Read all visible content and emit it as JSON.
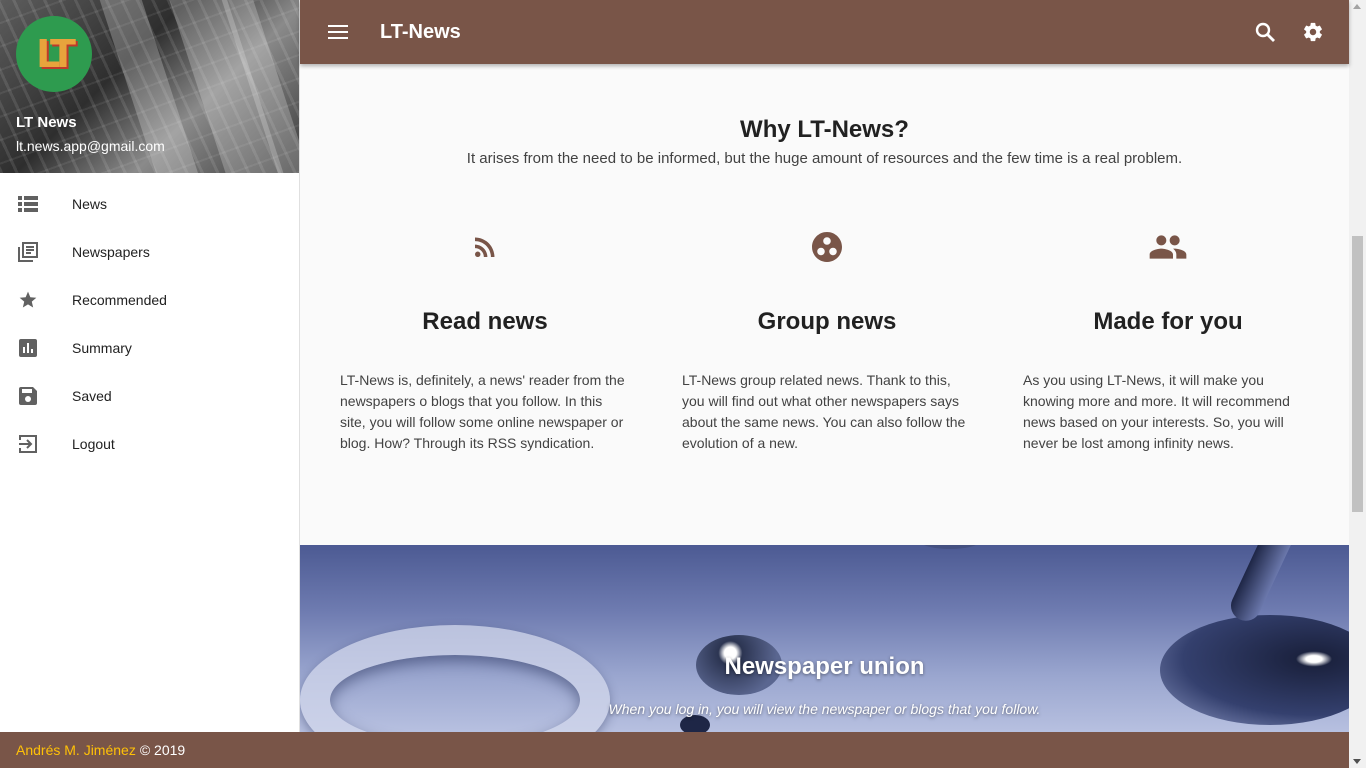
{
  "app": {
    "title": "LT-News",
    "brand_color": "#795548",
    "accent_color": "#ffc107"
  },
  "sidebar": {
    "avatar_text": "LT",
    "user_name": "LT News",
    "user_email": "lt.news.app@gmail.com",
    "items": [
      {
        "label": "News",
        "icon": "view-list-icon"
      },
      {
        "label": "Newspapers",
        "icon": "library-books-icon"
      },
      {
        "label": "Recommended",
        "icon": "star-icon"
      },
      {
        "label": "Summary",
        "icon": "bar-chart-icon"
      },
      {
        "label": "Saved",
        "icon": "save-icon"
      },
      {
        "label": "Logout",
        "icon": "exit-to-app-icon"
      }
    ]
  },
  "toolbar": {
    "menu_icon": "menu-icon",
    "search_icon": "search-icon",
    "settings_icon": "settings-icon"
  },
  "main": {
    "why_title": "Why LT-News?",
    "why_subtitle": "It arises from the need to be informed, but the huge amount of resources and the few time is a real problem.",
    "features": [
      {
        "icon": "rss-feed-icon",
        "title": "Read news",
        "text": "LT-News is, definitely, a news' reader from the newspapers o blogs that you follow. In this site, you will follow some online newspaper or blog. How? Through its RSS syndication."
      },
      {
        "icon": "group-work-icon",
        "title": "Group news",
        "text": "LT-News group related news. Thank to this, you will find out what other newspapers says about the same news. You can also follow the evolution of a new."
      },
      {
        "icon": "people-icon",
        "title": "Made for you",
        "text": "As you using LT-News, it will make you knowing more and more. It will recommend news based on your interests. So, you will never be lost among infinity news."
      }
    ],
    "banner": {
      "title": "Newspaper union",
      "subtitle": "When you log in, you will view the newspaper or blogs that you follow."
    }
  },
  "footer": {
    "author": "Andrés M. Jiménez",
    "copyright": "© 2019"
  }
}
